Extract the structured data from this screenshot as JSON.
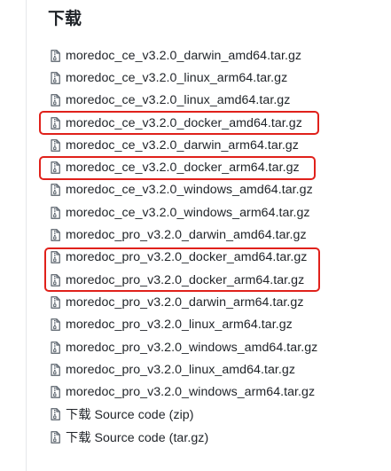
{
  "section": {
    "title": "下载"
  },
  "assets": [
    {
      "label": "moredoc_ce_v3.2.0_darwin_amd64.tar.gz",
      "icon": "file-zip-icon",
      "highlighted": false
    },
    {
      "label": "moredoc_ce_v3.2.0_linux_arm64.tar.gz",
      "icon": "file-zip-icon",
      "highlighted": false
    },
    {
      "label": "moredoc_ce_v3.2.0_linux_amd64.tar.gz",
      "icon": "file-zip-icon",
      "highlighted": false
    },
    {
      "label": "moredoc_ce_v3.2.0_docker_amd64.tar.gz",
      "icon": "file-zip-icon",
      "highlighted": true
    },
    {
      "label": "moredoc_ce_v3.2.0_darwin_arm64.tar.gz",
      "icon": "file-zip-icon",
      "highlighted": false
    },
    {
      "label": "moredoc_ce_v3.2.0_docker_arm64.tar.gz",
      "icon": "file-zip-icon",
      "highlighted": true
    },
    {
      "label": "moredoc_ce_v3.2.0_windows_amd64.tar.gz",
      "icon": "file-zip-icon",
      "highlighted": false
    },
    {
      "label": "moredoc_ce_v3.2.0_windows_arm64.tar.gz",
      "icon": "file-zip-icon",
      "highlighted": false
    },
    {
      "label": "moredoc_pro_v3.2.0_darwin_amd64.tar.gz",
      "icon": "file-zip-icon",
      "highlighted": false
    },
    {
      "label": "moredoc_pro_v3.2.0_docker_amd64.tar.gz",
      "icon": "file-zip-icon",
      "highlighted": true
    },
    {
      "label": "moredoc_pro_v3.2.0_docker_arm64.tar.gz",
      "icon": "file-zip-icon",
      "highlighted": true
    },
    {
      "label": "moredoc_pro_v3.2.0_darwin_arm64.tar.gz",
      "icon": "file-zip-icon",
      "highlighted": false
    },
    {
      "label": "moredoc_pro_v3.2.0_linux_arm64.tar.gz",
      "icon": "file-zip-icon",
      "highlighted": false
    },
    {
      "label": "moredoc_pro_v3.2.0_windows_amd64.tar.gz",
      "icon": "file-zip-icon",
      "highlighted": false
    },
    {
      "label": "moredoc_pro_v3.2.0_linux_amd64.tar.gz",
      "icon": "file-zip-icon",
      "highlighted": false
    },
    {
      "label": "moredoc_pro_v3.2.0_windows_arm64.tar.gz",
      "icon": "file-zip-icon",
      "highlighted": false
    },
    {
      "label": "下载 Source code (zip)",
      "icon": "file-zip-icon",
      "highlighted": false
    },
    {
      "label": "下载 Source code (tar.gz)",
      "icon": "file-zip-icon",
      "highlighted": false
    }
  ],
  "colors": {
    "highlight_border": "#e0211b",
    "text": "#1f2328",
    "icon": "#57606a"
  }
}
